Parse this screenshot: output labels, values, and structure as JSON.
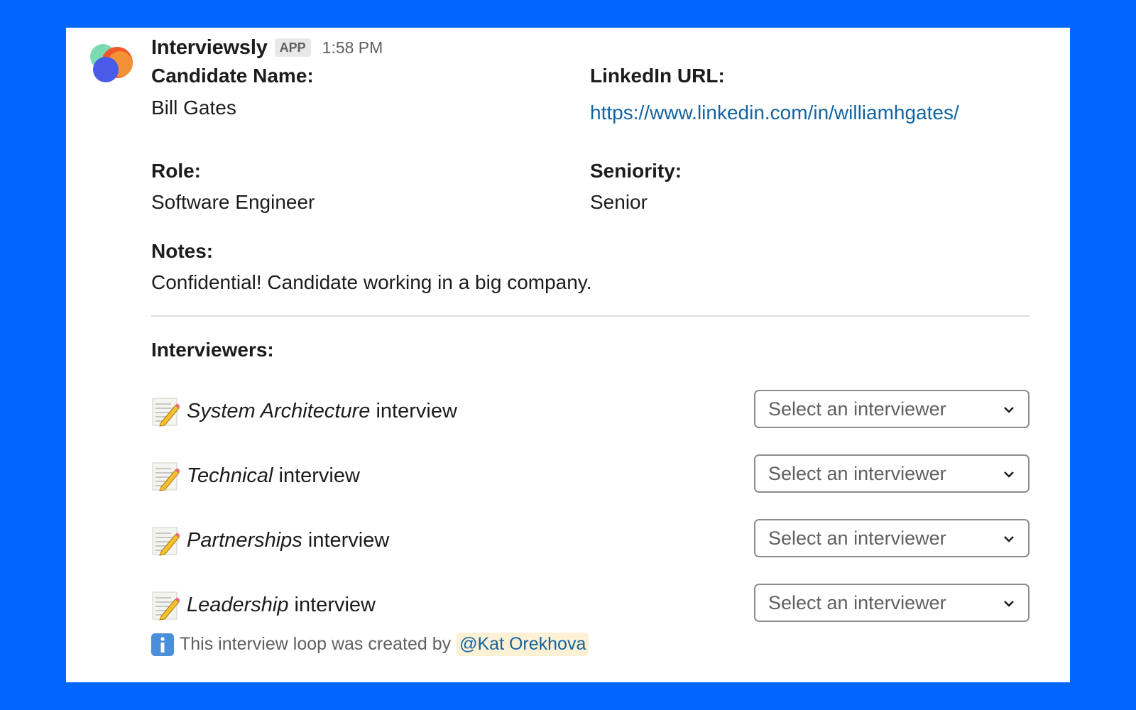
{
  "app": {
    "name": "Interviewsly",
    "badge": "APP",
    "time": "1:58 PM"
  },
  "fields": {
    "candidate_name_label": "Candidate Name:",
    "candidate_name": "Bill Gates",
    "linkedin_label": "LinkedIn URL:",
    "linkedin_url": "https://www.linkedin.com/in/williamhgates/",
    "role_label": "Role:",
    "role": "Software Engineer",
    "seniority_label": "Seniority:",
    "seniority": "Senior",
    "notes_label": "Notes:",
    "notes": "Confidential! Candidate working in a big company."
  },
  "interviewers": {
    "title": "Interviewers:",
    "rows": [
      {
        "name": "System Architecture",
        "suffix": " interview",
        "placeholder": "Select an interviewer"
      },
      {
        "name": "Technical",
        "suffix": " interview",
        "placeholder": "Select an interviewer"
      },
      {
        "name": "Partnerships",
        "suffix": " interview",
        "placeholder": "Select an interviewer"
      },
      {
        "name": "Leadership",
        "suffix": " interview",
        "placeholder": "Select an interviewer"
      }
    ]
  },
  "footer": {
    "text": "This interview loop was created by",
    "mention": "@Kat Orekhova"
  },
  "icons": {
    "row_icon": "memo-icon",
    "footer_icon": "info-icon",
    "dropdown_icon": "chevron-down-icon"
  },
  "colors": {
    "background": "#0066ff",
    "link": "#1264a3",
    "mention_bg": "#fdf1d5"
  }
}
